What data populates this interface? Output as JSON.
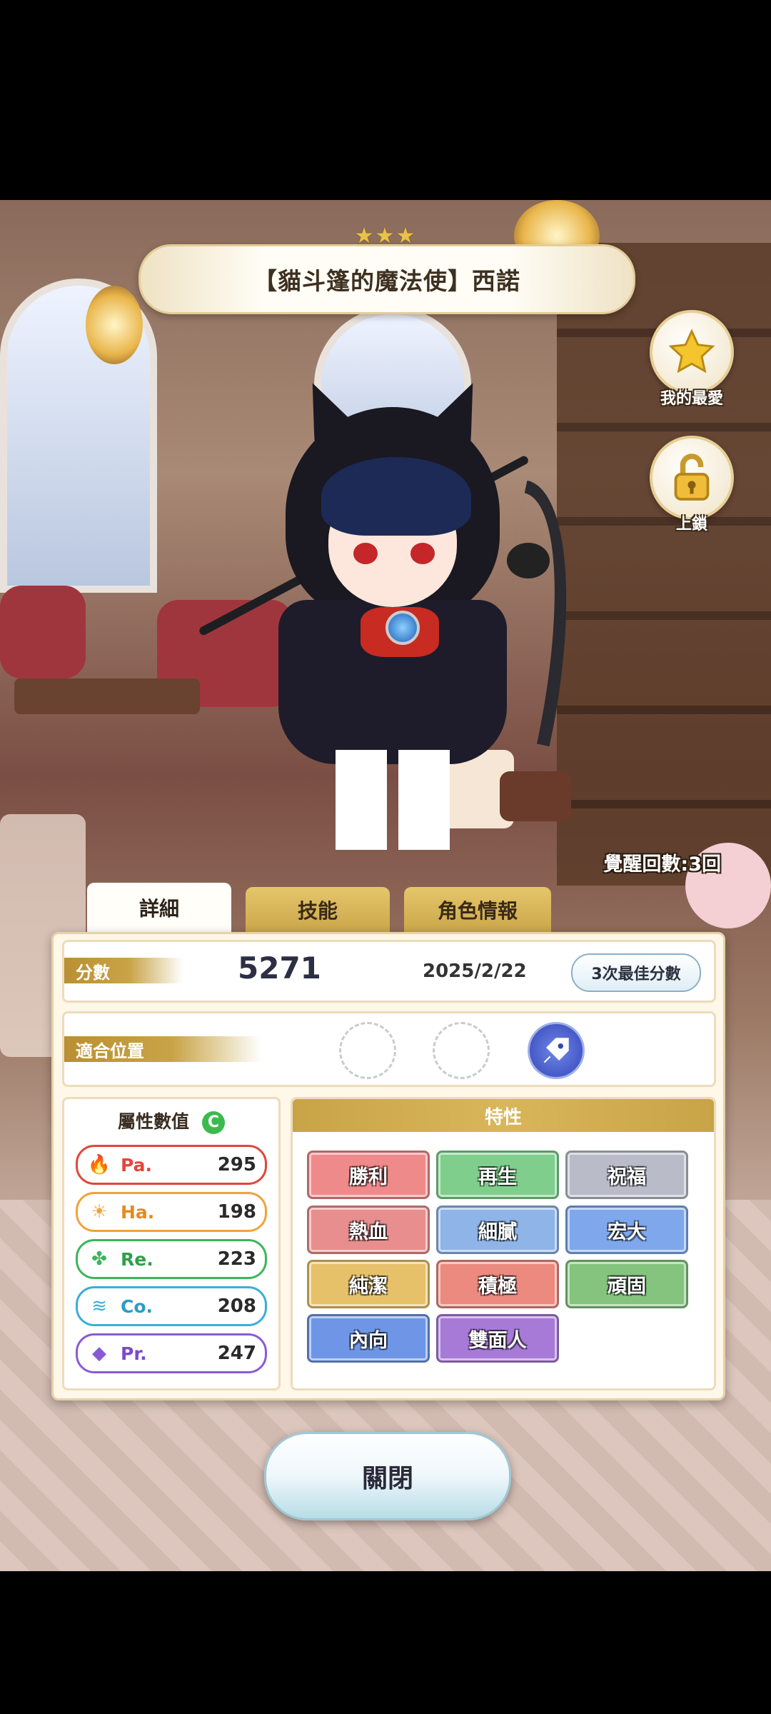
{
  "header": {
    "stars": "★★★",
    "title": "【貓斗篷的魔法使】西諾"
  },
  "side_buttons": {
    "favorite_label": "我的最愛",
    "lock_label": "上鎖"
  },
  "awaken_text": "覺醒回數:3回",
  "tabs": [
    {
      "label": "詳細",
      "active": true
    },
    {
      "label": "技能",
      "active": false
    },
    {
      "label": "角色情報",
      "active": false
    }
  ],
  "score": {
    "label": "分數",
    "value": "5271",
    "date": "2025/2/22",
    "best_button": "3次最佳分數"
  },
  "position": {
    "label": "適合位置",
    "slots": [
      "empty",
      "empty",
      "filled"
    ]
  },
  "attributes": {
    "heading": "屬性數值",
    "grade": "C",
    "items": [
      {
        "name": "Pa.",
        "value": "295",
        "color": "#e0473a",
        "icon": "flame-icon"
      },
      {
        "name": "Ha.",
        "value": "198",
        "color": "#f2a23a",
        "icon": "sun-icon"
      },
      {
        "name": "Re.",
        "value": "223",
        "color": "#3db55a",
        "icon": "clover-icon"
      },
      {
        "name": "Co.",
        "value": "208",
        "color": "#3aaed8",
        "icon": "wave-icon"
      },
      {
        "name": "Pr.",
        "value": "247",
        "color": "#8a5ad6",
        "icon": "diamond-icon"
      }
    ]
  },
  "traits": {
    "heading": "特性",
    "items": [
      {
        "label": "勝利",
        "color": "#ef8a8a"
      },
      {
        "label": "再生",
        "color": "#7fce8c"
      },
      {
        "label": "祝福",
        "color": "#b9bcc8"
      },
      {
        "label": "熱血",
        "color": "#e88e8e"
      },
      {
        "label": "細膩",
        "color": "#8fb4e8"
      },
      {
        "label": "宏大",
        "color": "#7fa8ec"
      },
      {
        "label": "純潔",
        "color": "#e7c06a"
      },
      {
        "label": "積極",
        "color": "#ec8a80"
      },
      {
        "label": "頑固",
        "color": "#84c47e"
      },
      {
        "label": "內向",
        "color": "#6f96e6"
      },
      {
        "label": "雙面人",
        "color": "#a77ad8"
      }
    ]
  },
  "close_button": "關閉"
}
